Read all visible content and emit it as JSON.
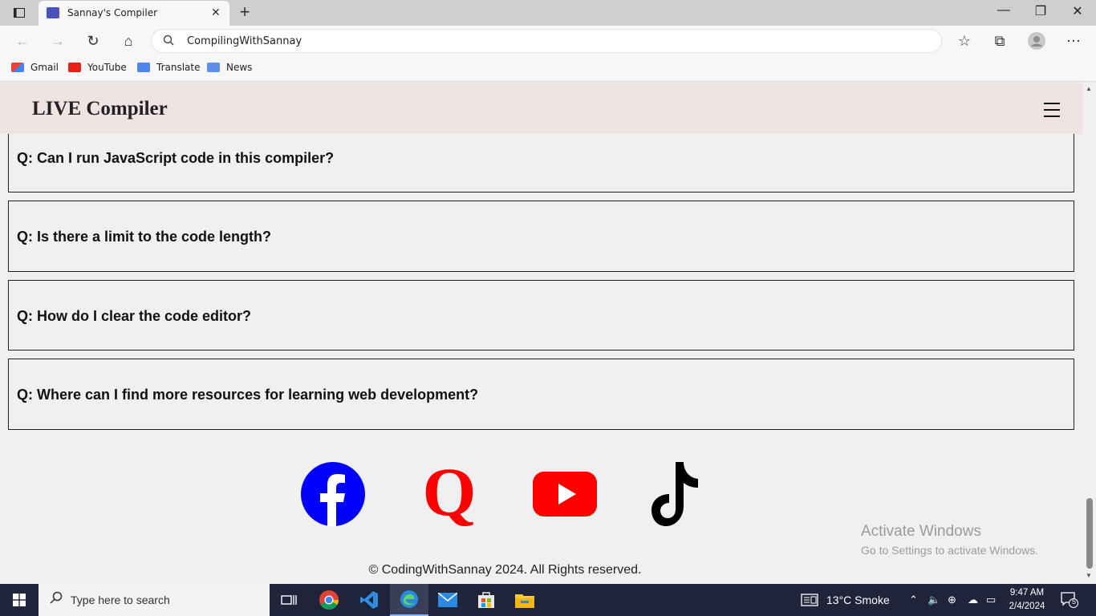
{
  "browser": {
    "tab_title": "Sannay's Compiler",
    "address": "CompilingWithSannay",
    "bookmarks": [
      {
        "label": "Gmail",
        "icon": "gmail-icon"
      },
      {
        "label": "YouTube",
        "icon": "youtube-icon"
      },
      {
        "label": "Translate",
        "icon": "translate-icon"
      },
      {
        "label": "News",
        "icon": "news-icon"
      }
    ]
  },
  "site": {
    "title": "LIVE Compiler",
    "faq": [
      {
        "question": "Q: Can I run JavaScript code in this compiler?"
      },
      {
        "question": "Q: Is there a limit to the code length?"
      },
      {
        "question": "Q: How do I clear the code editor?"
      },
      {
        "question": "Q: Where can I find more resources for learning web development?"
      }
    ],
    "socials": [
      {
        "icon": "facebook-icon",
        "color": "#0000ff"
      },
      {
        "icon": "quora-icon",
        "color": "#ff0000"
      },
      {
        "icon": "youtube-icon",
        "color": "#ff0000"
      },
      {
        "icon": "tiktok-icon",
        "color": "#000000"
      }
    ],
    "copyright": "© CodingWithSannay 2024. All Rights reserved."
  },
  "watermark": {
    "title": "Activate Windows",
    "subtitle": "Go to Settings to activate Windows."
  },
  "taskbar": {
    "search_placeholder": "Type here to search",
    "weather": "13°C  Smoke",
    "time": "9:47 AM",
    "date": "2/4/2024",
    "notifications": "5"
  }
}
